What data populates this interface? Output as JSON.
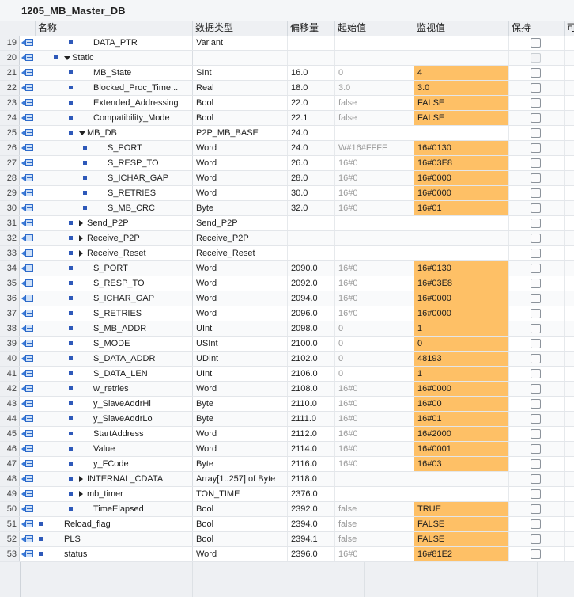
{
  "window": {
    "title": "1205_MB_Master_DB"
  },
  "columns": {
    "name": "名称",
    "type": "数据类型",
    "offset": "偏移量",
    "start": "起始值",
    "monitor": "监视值",
    "retain": "保持",
    "extra": "可"
  },
  "rows": [
    {
      "line": "19",
      "level": 2,
      "expand": "",
      "name": "DATA_PTR",
      "type": "Variant",
      "offset": "",
      "start": "",
      "monitor": "",
      "hl": false
    },
    {
      "line": "20",
      "level": 1,
      "expand": "down",
      "name": "Static",
      "type": "",
      "offset": "",
      "start": "",
      "monitor": "",
      "hl": false,
      "retain_dim": true
    },
    {
      "line": "21",
      "level": 2,
      "expand": "",
      "name": "MB_State",
      "type": "SInt",
      "offset": "16.0",
      "start": "0",
      "monitor": "4",
      "hl": true
    },
    {
      "line": "22",
      "level": 2,
      "expand": "",
      "name": "Blocked_Proc_Time...",
      "type": "Real",
      "offset": "18.0",
      "start": "3.0",
      "monitor": "3.0",
      "hl": true
    },
    {
      "line": "23",
      "level": 2,
      "expand": "",
      "name": "Extended_Addressing",
      "type": "Bool",
      "offset": "22.0",
      "start": "false",
      "monitor": "FALSE",
      "hl": true
    },
    {
      "line": "24",
      "level": 2,
      "expand": "",
      "name": "Compatibility_Mode",
      "type": "Bool",
      "offset": "22.1",
      "start": "false",
      "monitor": "FALSE",
      "hl": true
    },
    {
      "line": "25",
      "level": 2,
      "expand": "down",
      "name": "MB_DB",
      "type": "P2P_MB_BASE",
      "offset": "24.0",
      "start": "",
      "monitor": "",
      "hl": false
    },
    {
      "line": "26",
      "level": 3,
      "expand": "",
      "name": "S_PORT",
      "type": "Word",
      "offset": "24.0",
      "start": "W#16#FFFF",
      "monitor": "16#0130",
      "hl": true
    },
    {
      "line": "27",
      "level": 3,
      "expand": "",
      "name": "S_RESP_TO",
      "type": "Word",
      "offset": "26.0",
      "start": "16#0",
      "monitor": "16#03E8",
      "hl": true
    },
    {
      "line": "28",
      "level": 3,
      "expand": "",
      "name": "S_ICHAR_GAP",
      "type": "Word",
      "offset": "28.0",
      "start": "16#0",
      "monitor": "16#0000",
      "hl": true
    },
    {
      "line": "29",
      "level": 3,
      "expand": "",
      "name": "S_RETRIES",
      "type": "Word",
      "offset": "30.0",
      "start": "16#0",
      "monitor": "16#0000",
      "hl": true
    },
    {
      "line": "30",
      "level": 3,
      "expand": "",
      "name": "S_MB_CRC",
      "type": "Byte",
      "offset": "32.0",
      "start": "16#0",
      "monitor": "16#01",
      "hl": true
    },
    {
      "line": "31",
      "level": 2,
      "expand": "right",
      "name": "Send_P2P",
      "type": "Send_P2P",
      "offset": "",
      "start": "",
      "monitor": "",
      "hl": false
    },
    {
      "line": "32",
      "level": 2,
      "expand": "right",
      "name": "Receive_P2P",
      "type": "Receive_P2P",
      "offset": "",
      "start": "",
      "monitor": "",
      "hl": false
    },
    {
      "line": "33",
      "level": 2,
      "expand": "right",
      "name": "Receive_Reset",
      "type": "Receive_Reset",
      "offset": "",
      "start": "",
      "monitor": "",
      "hl": false
    },
    {
      "line": "34",
      "level": 2,
      "expand": "",
      "name": "S_PORT",
      "type": "Word",
      "offset": "2090.0",
      "start": "16#0",
      "monitor": "16#0130",
      "hl": true
    },
    {
      "line": "35",
      "level": 2,
      "expand": "",
      "name": "S_RESP_TO",
      "type": "Word",
      "offset": "2092.0",
      "start": "16#0",
      "monitor": "16#03E8",
      "hl": true
    },
    {
      "line": "36",
      "level": 2,
      "expand": "",
      "name": "S_ICHAR_GAP",
      "type": "Word",
      "offset": "2094.0",
      "start": "16#0",
      "monitor": "16#0000",
      "hl": true
    },
    {
      "line": "37",
      "level": 2,
      "expand": "",
      "name": "S_RETRIES",
      "type": "Word",
      "offset": "2096.0",
      "start": "16#0",
      "monitor": "16#0000",
      "hl": true
    },
    {
      "line": "38",
      "level": 2,
      "expand": "",
      "name": "S_MB_ADDR",
      "type": "UInt",
      "offset": "2098.0",
      "start": "0",
      "monitor": "1",
      "hl": true
    },
    {
      "line": "39",
      "level": 2,
      "expand": "",
      "name": "S_MODE",
      "type": "USInt",
      "offset": "2100.0",
      "start": "0",
      "monitor": "0",
      "hl": true
    },
    {
      "line": "40",
      "level": 2,
      "expand": "",
      "name": "S_DATA_ADDR",
      "type": "UDInt",
      "offset": "2102.0",
      "start": "0",
      "monitor": "48193",
      "hl": true
    },
    {
      "line": "41",
      "level": 2,
      "expand": "",
      "name": "S_DATA_LEN",
      "type": "UInt",
      "offset": "2106.0",
      "start": "0",
      "monitor": "1",
      "hl": true
    },
    {
      "line": "42",
      "level": 2,
      "expand": "",
      "name": "w_retries",
      "type": "Word",
      "offset": "2108.0",
      "start": "16#0",
      "monitor": "16#0000",
      "hl": true
    },
    {
      "line": "43",
      "level": 2,
      "expand": "",
      "name": "y_SlaveAddrHi",
      "type": "Byte",
      "offset": "2110.0",
      "start": "16#0",
      "monitor": "16#00",
      "hl": true
    },
    {
      "line": "44",
      "level": 2,
      "expand": "",
      "name": "y_SlaveAddrLo",
      "type": "Byte",
      "offset": "2111.0",
      "start": "16#0",
      "monitor": "16#01",
      "hl": true
    },
    {
      "line": "45",
      "level": 2,
      "expand": "",
      "name": "StartAddress",
      "type": "Word",
      "offset": "2112.0",
      "start": "16#0",
      "monitor": "16#2000",
      "hl": true
    },
    {
      "line": "46",
      "level": 2,
      "expand": "",
      "name": "Value",
      "type": "Word",
      "offset": "2114.0",
      "start": "16#0",
      "monitor": "16#0001",
      "hl": true
    },
    {
      "line": "47",
      "level": 2,
      "expand": "",
      "name": "y_FCode",
      "type": "Byte",
      "offset": "2116.0",
      "start": "16#0",
      "monitor": "16#03",
      "hl": true
    },
    {
      "line": "48",
      "level": 2,
      "expand": "right",
      "name": "INTERNAL_CDATA",
      "type": "Array[1..257] of Byte",
      "offset": "2118.0",
      "start": "",
      "monitor": "",
      "hl": false
    },
    {
      "line": "49",
      "level": 2,
      "expand": "right",
      "name": "mb_timer",
      "type": "TON_TIME",
      "offset": "2376.0",
      "start": "",
      "monitor": "",
      "hl": false
    },
    {
      "line": "50",
      "level": 2,
      "expand": "",
      "name": "TimeElapsed",
      "type": "Bool",
      "offset": "2392.0",
      "start": "false",
      "monitor": "TRUE",
      "hl": true
    },
    {
      "line": "51",
      "level": 0,
      "expand": "",
      "name": "Reload_flag",
      "type": "Bool",
      "offset": "2394.0",
      "start": "false",
      "monitor": "FALSE",
      "hl": true
    },
    {
      "line": "52",
      "level": 0,
      "expand": "",
      "name": "PLS",
      "type": "Bool",
      "offset": "2394.1",
      "start": "false",
      "monitor": "FALSE",
      "hl": true
    },
    {
      "line": "53",
      "level": 0,
      "expand": "",
      "name": "status",
      "type": "Word",
      "offset": "2396.0",
      "start": "16#0",
      "monitor": "16#81E2",
      "hl": true
    }
  ],
  "icons": {
    "row_icon": "db-interface-icon",
    "member_marker": "blue-square-bullet",
    "expanded": "expand-down-arrow",
    "collapsed": "expand-right-arrow"
  },
  "colors": {
    "monitor_highlight": "#fec066",
    "bullet": "#2e59b9"
  }
}
